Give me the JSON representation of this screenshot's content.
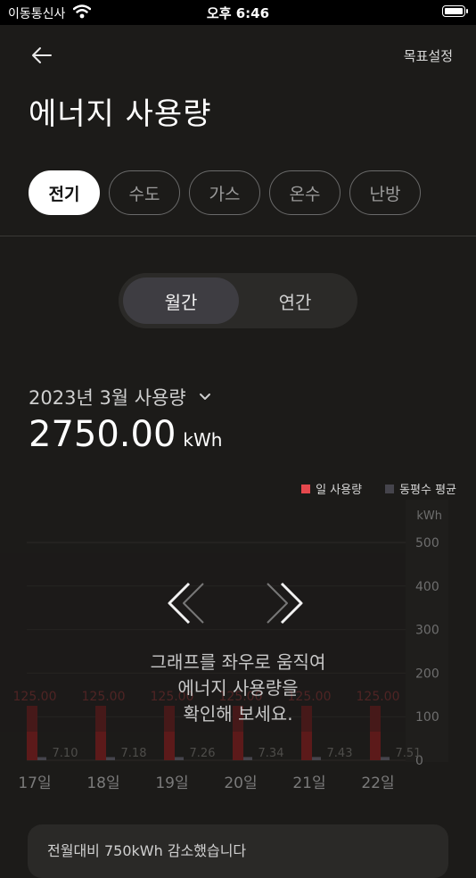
{
  "status_bar": {
    "carrier": "이동통신사",
    "time": "오후 6:46"
  },
  "header": {
    "back_label": "←",
    "goal_setting": "목표설정"
  },
  "page_title": "에너지 사용량",
  "utility_tabs": [
    {
      "label": "전기",
      "active": true
    },
    {
      "label": "수도",
      "active": false
    },
    {
      "label": "가스",
      "active": false
    },
    {
      "label": "온수",
      "active": false
    },
    {
      "label": "난방",
      "active": false
    }
  ],
  "period_toggle": {
    "monthly": "월간",
    "yearly": "연간",
    "selected": "monthly"
  },
  "period_label": "2023년 3월 사용량",
  "total": {
    "value": "2750.00",
    "unit": "kWh"
  },
  "legend": {
    "daily": "일 사용량",
    "average": "동평수 평균"
  },
  "colors": {
    "daily": "#e5484d",
    "average": "#45444c",
    "bar": "#5c1a1a"
  },
  "chart_data": {
    "type": "bar",
    "categories": [
      "17일",
      "18일",
      "19일",
      "20일",
      "21일",
      "22일"
    ],
    "series": [
      {
        "name": "일 사용량",
        "values": [
          125.0,
          125.0,
          125.0,
          125.0,
          125.0,
          125.0
        ]
      },
      {
        "name": "동평수 평균",
        "values": [
          7.1,
          7.18,
          7.26,
          7.34,
          7.43,
          7.51
        ]
      }
    ],
    "value_labels": [
      "125.00",
      "125.00",
      "125.00",
      "125.00",
      "125.00",
      "125.00"
    ],
    "avg_labels": [
      "7.10",
      "7.18",
      "7.26",
      "7.34",
      "7.43",
      "7.51"
    ],
    "y_unit": "kWh",
    "yticks": [
      500,
      400,
      300,
      200,
      100,
      0
    ],
    "ylim": [
      0,
      500
    ],
    "grid": true
  },
  "hint": {
    "line1": "그래프를 좌우로 움직여",
    "line2": "에너지 사용량을",
    "line3": "확인해 보세요."
  },
  "bottom_card": {
    "text": "전월대비 750kWh 감소했습니다"
  }
}
